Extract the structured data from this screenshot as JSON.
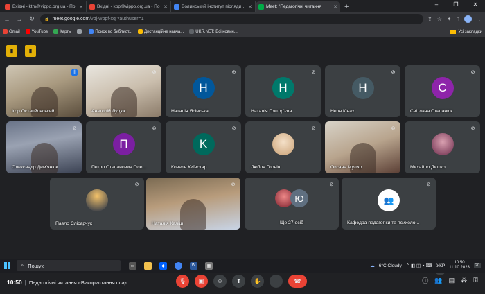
{
  "tabs": [
    {
      "title": "Вхідні - ktm@vippo.org.ua - По",
      "color": "#ea4335"
    },
    {
      "title": "Вхідні - kpp@vippo.org.ua - По",
      "color": "#ea4335"
    },
    {
      "title": "Волинський інститут післядипл",
      "color": "#4285f4"
    },
    {
      "title": "Meet: \"Педагогічні читання",
      "color": "#00ac47"
    }
  ],
  "window_controls": [
    "–",
    "❐",
    "✕"
  ],
  "address": {
    "host": "meet.google.com",
    "path": "/vbj-wppf-xqj?authuser=1"
  },
  "bookmarks": [
    {
      "label": "Gmail",
      "color": "#ea4335"
    },
    {
      "label": "YouTube",
      "color": "#ff0000"
    },
    {
      "label": "Карты",
      "color": "#34a853"
    },
    {
      "label": "",
      "color": "#9aa0a6"
    },
    {
      "label": "Поиск по библиот...",
      "color": "#4285f4"
    },
    {
      "label": "Дистанційне навча...",
      "color": "#fbbc04"
    },
    {
      "label": "UKR.NET: Всі новин...",
      "color": "#5f6368"
    }
  ],
  "bookmarks_right": "Усі закладки",
  "tiles": [
    {
      "name": "Ігор Остапйовський",
      "kind": "video",
      "speaking": true
    },
    {
      "name": "Анатолій Луцюк",
      "kind": "video"
    },
    {
      "name": "Наталія Ясінська",
      "kind": "letter",
      "letter": "H",
      "color": "#01579b"
    },
    {
      "name": "Наталія Григор'єва",
      "kind": "letter",
      "letter": "H",
      "color": "#00796b"
    },
    {
      "name": "Неля Кінах",
      "kind": "letter",
      "letter": "H",
      "color": "#455a64"
    },
    {
      "name": "Світлана Степанюк",
      "kind": "letter",
      "letter": "C",
      "color": "#8e24aa"
    },
    {
      "name": "Олександр Дем'янюк",
      "kind": "video"
    },
    {
      "name": "Петро Степанович Оле...",
      "kind": "letter",
      "letter": "П",
      "color": "#7b1fa2"
    },
    {
      "name": "Ковель Київстар",
      "kind": "letter",
      "letter": "K",
      "color": "#00695c"
    },
    {
      "name": "Любов Горніч",
      "kind": "photo"
    },
    {
      "name": "Оксана Муляр",
      "kind": "video"
    },
    {
      "name": "Михайло Дишко",
      "kind": "photo"
    },
    {
      "name": "Павло Слісарчук",
      "kind": "photo"
    },
    {
      "name": "Наталія Каліш",
      "kind": "video"
    },
    {
      "name": "Ще 27 осіб",
      "kind": "more",
      "letter": "Ю"
    },
    {
      "name": "Кафедра педагогіки та психоло...",
      "kind": "group"
    }
  ],
  "bottom": {
    "time": "10:50",
    "separator": "|",
    "title": "Педагогічні читання «Використання спадщи...",
    "badge": "43"
  },
  "taskbar": {
    "search_placeholder": "Пошук",
    "weather": "6°C  Cloudy",
    "lang": "УКР",
    "time": "10:50",
    "date": "11.10.2023",
    "notif": "20"
  }
}
